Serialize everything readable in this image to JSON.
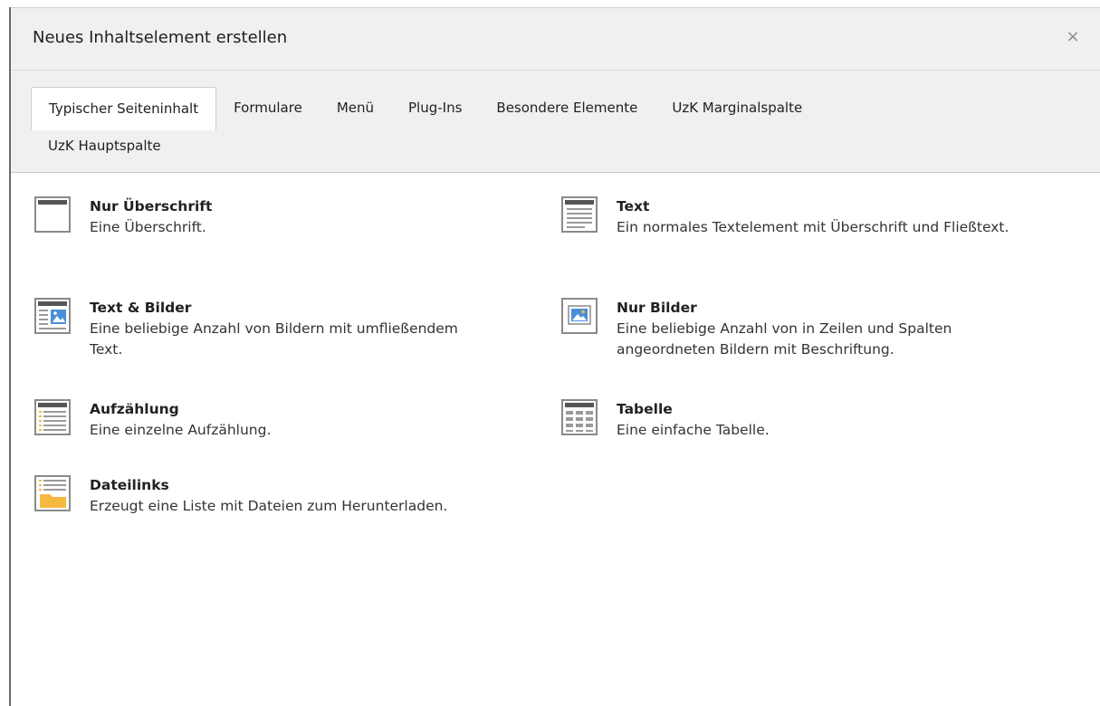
{
  "modal": {
    "title": "Neues Inhaltselement erstellen",
    "close_label": "×"
  },
  "tabs": [
    {
      "label": "Typischer Seiteninhalt",
      "active": true
    },
    {
      "label": "Formulare"
    },
    {
      "label": "Menü"
    },
    {
      "label": "Plug-Ins"
    },
    {
      "label": "Besondere Elemente"
    },
    {
      "label": "UzK Marginalspalte"
    },
    {
      "label": "UzK Hauptspalte"
    }
  ],
  "elements": [
    {
      "name": "Nur Überschrift",
      "description": "Eine Überschrift.",
      "icon": "header-icon"
    },
    {
      "name": "Text",
      "description": "Ein normales Textelement mit Überschrift und Fließtext.",
      "icon": "text-icon"
    },
    {
      "name": "Text & Bilder",
      "description": "Eine beliebige Anzahl von Bildern mit umfließendem Text.",
      "icon": "text-images-icon"
    },
    {
      "name": "Nur Bilder",
      "description": "Eine beliebige Anzahl von in Zeilen und Spalten angeordneten Bildern mit Beschriftung.",
      "icon": "images-icon"
    },
    {
      "name": "Aufzählung",
      "description": "Eine einzelne Aufzählung.",
      "icon": "bullets-icon"
    },
    {
      "name": "Tabelle",
      "description": "Eine einfache Tabelle.",
      "icon": "table-icon"
    },
    {
      "name": "Dateilinks",
      "description": "Erzeugt eine Liste mit Dateien zum Herunterladen.",
      "icon": "filelinks-icon"
    }
  ],
  "colors": {
    "header_bg": "#f0f0f0",
    "icon_border": "#8a8a8a",
    "icon_blue": "#4a90d9",
    "icon_orange": "#f5b942"
  }
}
